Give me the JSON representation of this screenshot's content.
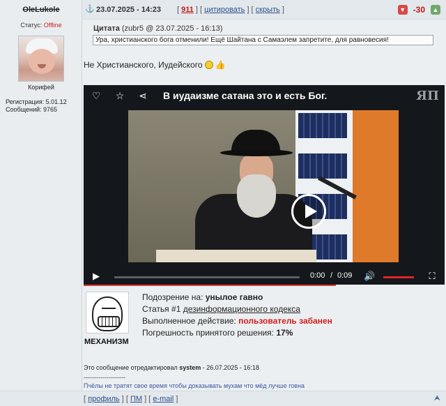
{
  "author": {
    "nick": "OleLukole",
    "status_label": "Статус:",
    "status_value": "Offline",
    "rank": "Корифей",
    "registration": "Регистрация: 5.01.12",
    "messages": "Сообщений: 9765"
  },
  "header": {
    "anchor_icon": "anchor-icon",
    "datetime": "23.07.2025 - 14:23",
    "post_number": "911",
    "quote_label": "цитировать",
    "hide_label": "скрыть",
    "rating": "-30"
  },
  "quote": {
    "title": "Цитата",
    "source": "(zubr5 @ 23.07.2025 - 16:13)",
    "text": "Ура, христианского бога отменили! Ещё Шайтана с Самаэлем запретите, для равновесия!"
  },
  "post_text": "Не Христианского, Иудейского",
  "video": {
    "title": "В иудаизме сатана это и есть Бог.",
    "logo": "ЯП",
    "time_current": "0:00",
    "time_separator": "/",
    "time_total": "0:09",
    "progress": 0.0,
    "volume": 1.0
  },
  "ban": {
    "label": "МЕХАНИЗМ",
    "suspicion_label": "Подозрение на:",
    "suspicion_value": "унылое гавно",
    "article_prefix": "Статья #1",
    "article_link": "дезинформационного кодекса",
    "action_label": "Выполненное действие:",
    "action_value": "пользователь забанен",
    "error_label": "Погрешность принятого решения:",
    "error_value": "17%"
  },
  "edited": {
    "prefix": "Это сообщение отредактировал",
    "user": "system",
    "suffix": "- 26.07.2025 - 16:18"
  },
  "separator": "--------------------",
  "signature": "Пчёлы не тратят свое время чтобы доказывать мухам что мёд лучше говна",
  "footer": {
    "profile": "профиль",
    "pm": "ПМ",
    "email": "e-mail"
  },
  "colors": {
    "accent_link": "#2a4f8a",
    "offline": "#cc2222",
    "negative": "#c01818",
    "ban_red": "#d21d1d"
  }
}
